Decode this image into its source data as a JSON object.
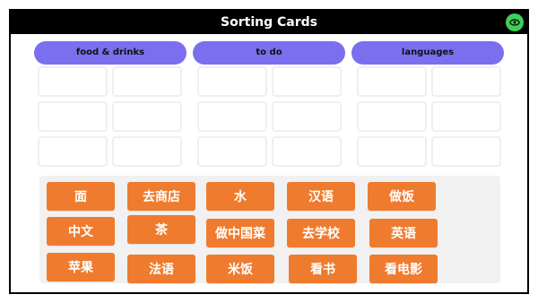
{
  "app": {
    "title": "Sorting Cards",
    "accent": "#7b6ff0",
    "card_color": "#ef7b2e",
    "eye_button_color": "#3ecf5a",
    "eye_icon": "eye-icon"
  },
  "categories": [
    {
      "label": "food & drinks"
    },
    {
      "label": "to do"
    },
    {
      "label": "languages"
    }
  ],
  "cards": [
    {
      "label": "面"
    },
    {
      "label": "去商店"
    },
    {
      "label": "水"
    },
    {
      "label": "汉语"
    },
    {
      "label": "做饭"
    },
    {
      "label": "中文"
    },
    {
      "label": "茶"
    },
    {
      "label": "做中国菜"
    },
    {
      "label": "去学校"
    },
    {
      "label": "英语"
    },
    {
      "label": "苹果"
    },
    {
      "label": "法语"
    },
    {
      "label": "米饭"
    },
    {
      "label": "看书"
    },
    {
      "label": "看电影"
    }
  ]
}
